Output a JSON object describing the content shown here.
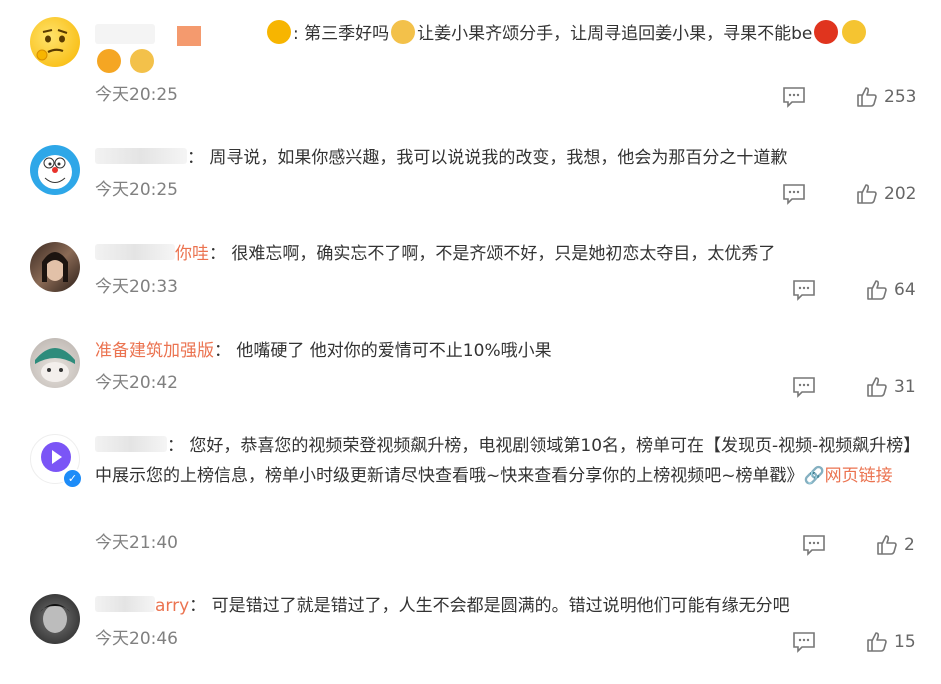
{
  "comments": [
    {
      "user_suffix": "",
      "text": "第三季好吗",
      "text2": "让姜小果齐颂分手，让周寻追回姜小果，寻果不能be",
      "time": "今天20:25",
      "likes": "253"
    },
    {
      "user_suffix": "",
      "text": "周寻说，如果你感兴趣，我可以说说我的改变，我想，他会为那百分之十道歉",
      "time": "今天20:25",
      "likes": "202"
    },
    {
      "user_suffix": "你哇",
      "text": "很难忘啊，确实忘不了啊，不是齐颂不好，只是她初恋太夺目，太优秀了",
      "time": "今天20:33",
      "likes": "64"
    },
    {
      "user_suffix": "准备建筑加强版",
      "text": "他嘴硬了 他对你的爱情可不止10%哦小果",
      "time": "今天20:42",
      "likes": "31"
    },
    {
      "user_suffix": "",
      "text": "您好，恭喜您的视频荣登视频飙升榜，电视剧领域第10名，榜单可在【发现页-视频-视频飙升榜】中展示您的上榜信息，榜单小时级更新请尽快查看哦~快来查看分享你的上榜视频吧~榜单戳》",
      "link": "网页链接",
      "time": "今天21:40",
      "likes": "2"
    },
    {
      "user_suffix": "arry",
      "text": "可是错过了就是错过了，人生不会都是圆满的。错过说明他们可能有缘无分吧",
      "time": "今天20:46",
      "likes": "15"
    }
  ],
  "colors": {
    "username": "#eb7350",
    "time": "#808080",
    "text": "#333333",
    "verified": "#1d8cf8"
  },
  "icons": {
    "reply": "comment-icon",
    "like": "thumbs-up-icon",
    "link": "link-icon"
  }
}
